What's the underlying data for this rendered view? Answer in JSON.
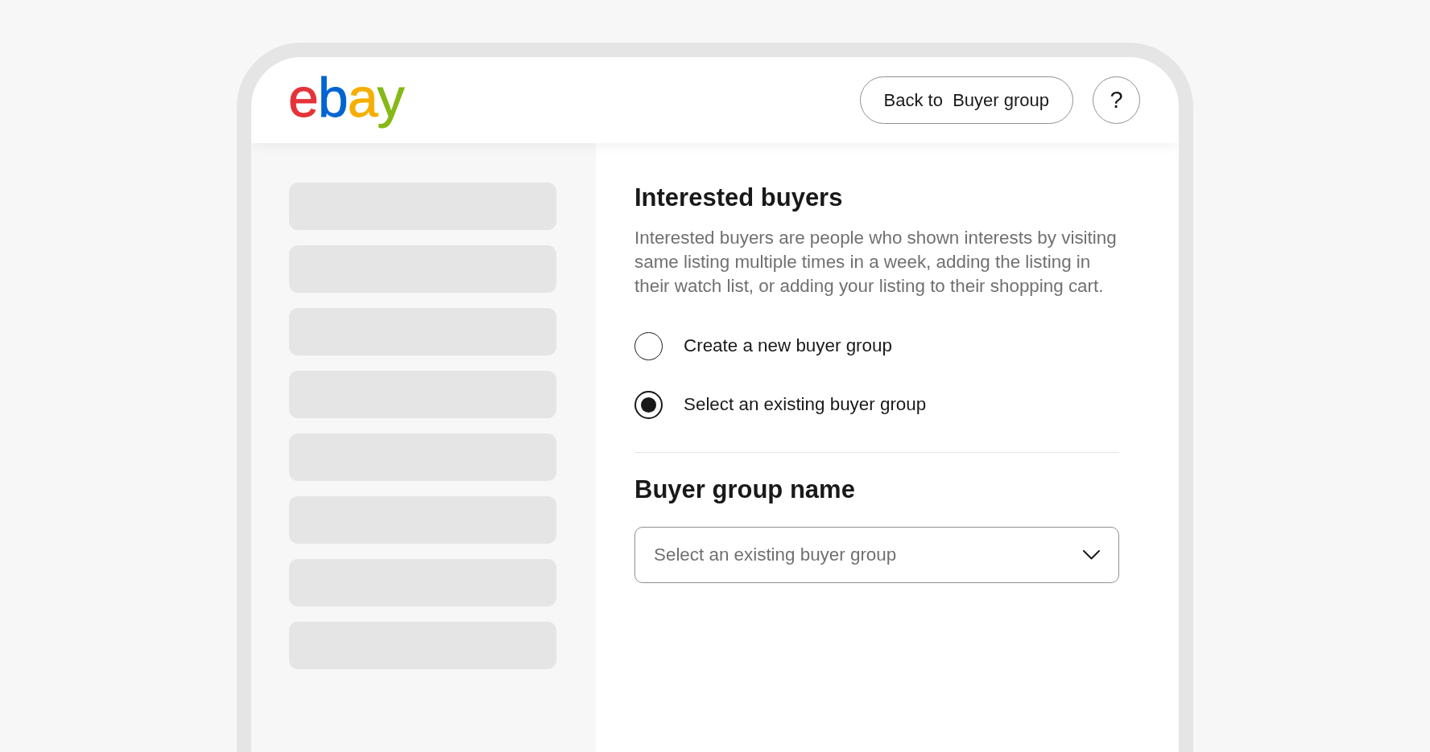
{
  "header": {
    "logo": {
      "letters": [
        {
          "text": "e",
          "color": "#e53238"
        },
        {
          "text": "b",
          "color": "#0064d2"
        },
        {
          "text": "a",
          "color": "#f5af02"
        },
        {
          "text": "y",
          "color": "#86b817"
        }
      ]
    },
    "back_button": {
      "label": "Back to  Buyer group"
    },
    "help_button": {
      "label": "?"
    }
  },
  "sidebar": {
    "items": [
      {
        "kind": "skeleton"
      },
      {
        "kind": "skeleton"
      },
      {
        "kind": "skeleton"
      },
      {
        "kind": "skeleton"
      },
      {
        "kind": "skeleton"
      },
      {
        "kind": "skeleton"
      },
      {
        "kind": "skeleton"
      },
      {
        "kind": "skeleton"
      }
    ]
  },
  "content": {
    "title": "Interested buyers",
    "description": "Interested buyers are people who shown interests by visiting same listing multiple times in a week, adding the listing in their watch list, or adding your listing to their shopping cart.",
    "options": [
      {
        "label": "Create a new buyer group",
        "selected": false
      },
      {
        "label": "Select an existing buyer group",
        "selected": true
      }
    ],
    "group_name": {
      "heading": "Buyer group name",
      "dropdown": {
        "placeholder": "Select an existing buyer group"
      }
    }
  }
}
